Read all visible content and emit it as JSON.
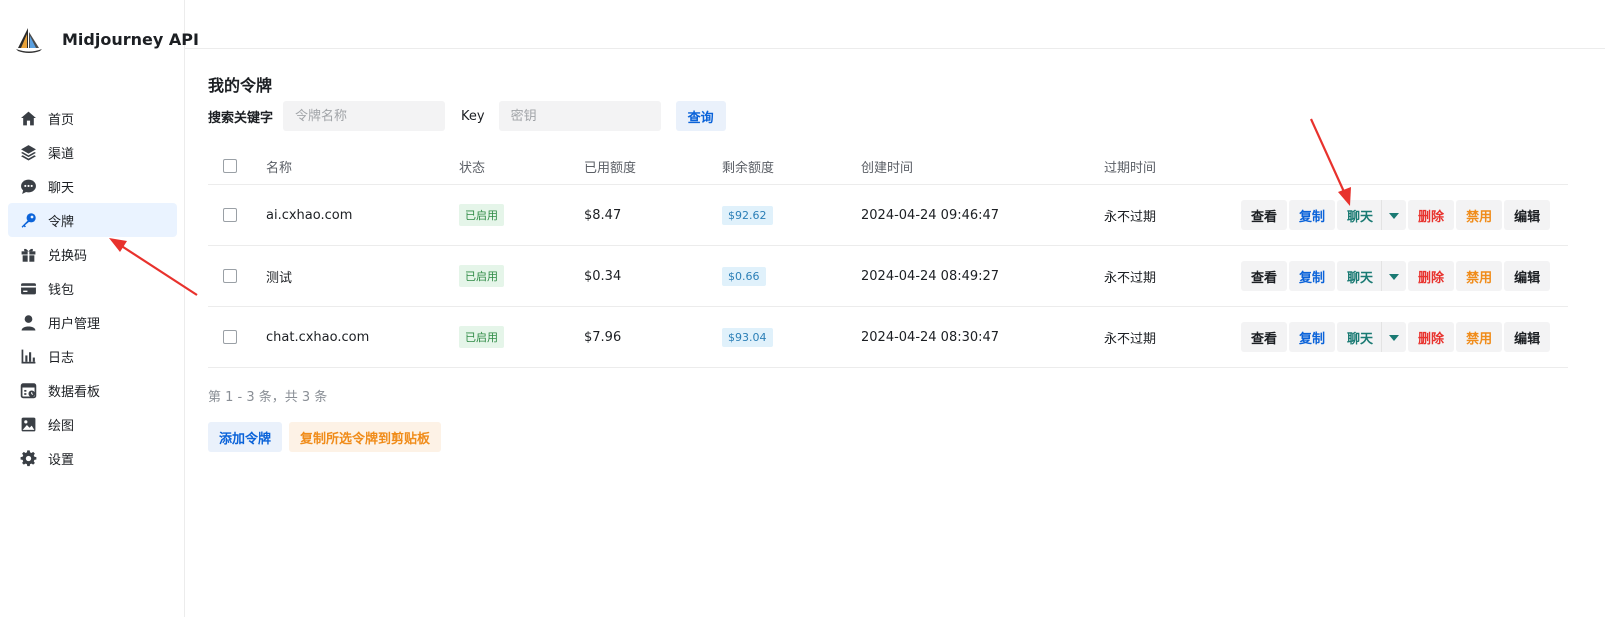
{
  "brand": {
    "name": "Midjourney API"
  },
  "sidebar": {
    "items": [
      {
        "label": "首页",
        "icon": "home-icon"
      },
      {
        "label": "渠道",
        "icon": "layers-icon"
      },
      {
        "label": "聊天",
        "icon": "chat-icon"
      },
      {
        "label": "令牌",
        "icon": "key-icon",
        "active": true
      },
      {
        "label": "兑换码",
        "icon": "gift-icon"
      },
      {
        "label": "钱包",
        "icon": "wallet-icon"
      },
      {
        "label": "用户管理",
        "icon": "user-icon"
      },
      {
        "label": "日志",
        "icon": "bar-chart-icon"
      },
      {
        "label": "数据看板",
        "icon": "calendar-icon"
      },
      {
        "label": "绘图",
        "icon": "image-icon"
      },
      {
        "label": "设置",
        "icon": "gear-icon"
      }
    ]
  },
  "main": {
    "title": "我的令牌",
    "search": {
      "keyword_label": "搜索关键字",
      "name_placeholder": "令牌名称",
      "key_label": "Key",
      "key_placeholder": "密钥",
      "query_label": "查询"
    },
    "table": {
      "headers": [
        "名称",
        "状态",
        "已用额度",
        "剩余额度",
        "创建时间",
        "过期时间"
      ],
      "rows": [
        {
          "name": "ai.cxhao.com",
          "status": "已启用",
          "used": "$8.47",
          "remaining": "$92.62",
          "created": "2024-04-24 09:46:47",
          "expire": "永不过期"
        },
        {
          "name": "测试",
          "status": "已启用",
          "used": "$0.34",
          "remaining": "$0.66",
          "created": "2024-04-24 08:49:27",
          "expire": "永不过期"
        },
        {
          "name": "chat.cxhao.com",
          "status": "已启用",
          "used": "$7.96",
          "remaining": "$93.04",
          "created": "2024-04-24 08:30:47",
          "expire": "永不过期"
        }
      ],
      "actions": {
        "view": "查看",
        "copy": "复制",
        "chat": "聊天",
        "delete": "删除",
        "disable": "禁用",
        "edit": "编辑"
      }
    },
    "pager": "第 1 - 3 条，共 3 条",
    "add_label": "添加令牌",
    "copy_selected_label": "复制所选令牌到剪贴板"
  },
  "colors": {
    "accent": "#0b63d9",
    "danger": "#e8322d",
    "warning": "#f08c1a",
    "success": "#2e8b45",
    "annotation": "#e8322d"
  }
}
